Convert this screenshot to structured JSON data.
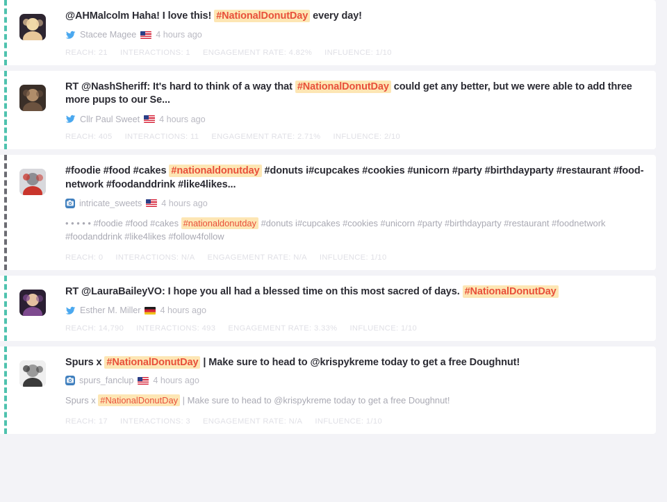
{
  "feed": {
    "metric_labels": {
      "reach": "REACH:",
      "interactions": "INTERACTIONS:",
      "engagement": "ENGAGEMENT RATE:",
      "influence": "INFLUENCE:"
    },
    "colors": {
      "page_background": "#f3f3f7",
      "card_background": "#ffffff",
      "twitter_stripe": "#4ec2ae",
      "instagram_stripe": "#6b6b72",
      "hashtag_highlight_bg": "#fde6b4",
      "hashtag_highlight_text": "#e8503a",
      "twitter_blue": "#4aa8ef",
      "instagram_blue": "#3f7fbe",
      "metrics_text": "#e0e0e6"
    },
    "posts": [
      {
        "id": "post-1",
        "network": "twitter",
        "network_icon": "twitter-bird-icon",
        "stripe_color": "#4ec2ae",
        "avatar_name": "avatar-stacee-magee",
        "text_parts": [
          {
            "text": "@AHMalcolm Haha! I love this! ",
            "highlight": false
          },
          {
            "text": "#NationalDonutDay",
            "highlight": true
          },
          {
            "text": " every day!",
            "highlight": false
          }
        ],
        "author": "Stacee Magee",
        "flag": "us",
        "time": "4 hours ago",
        "caption": null,
        "metrics": {
          "reach": "21",
          "interactions": "1",
          "engagement": "4.82%",
          "influence": "1/10"
        }
      },
      {
        "id": "post-2",
        "network": "twitter",
        "network_icon": "twitter-bird-icon",
        "stripe_color": "#4ec2ae",
        "avatar_name": "avatar-cllr-paul-sweet",
        "text_parts": [
          {
            "text": "RT @NashSheriff: It's hard to think of a way that ",
            "highlight": false
          },
          {
            "text": "#NationalDonutDay",
            "highlight": true
          },
          {
            "text": " could get any better, but we were able to add three more pups to our Se...",
            "highlight": false
          }
        ],
        "author": "Cllr Paul Sweet",
        "flag": "us",
        "time": "4 hours ago",
        "caption": null,
        "metrics": {
          "reach": "405",
          "interactions": "11",
          "engagement": "2.71%",
          "influence": "2/10"
        }
      },
      {
        "id": "post-3",
        "network": "instagram",
        "network_icon": "instagram-camera-icon",
        "stripe_color": "#6b6b72",
        "avatar_name": "avatar-intricate-sweets",
        "text_parts": [
          {
            "text": "#foodie #food #cakes ",
            "highlight": false
          },
          {
            "text": "#nationaldonutday",
            "highlight": true
          },
          {
            "text": " #donuts i#cupcakes #cookies #unicorn #party #birthdayparty #restaurant #food-network #foodanddrink #like4likes...",
            "highlight": false
          }
        ],
        "author": "intricate_sweets",
        "flag": "us",
        "time": "4 hours ago",
        "caption_parts": [
          {
            "text": "• • • • • #foodie #food #cakes ",
            "highlight": false
          },
          {
            "text": "#nationaldonutday",
            "highlight": true
          },
          {
            "text": " #donuts i#cupcakes #cookies #unicorn #party #birthdayparty #restaurant #foodnetwork #foodanddrink #like4likes #follow4follow",
            "highlight": false
          }
        ],
        "metrics": {
          "reach": "0",
          "interactions": "N/A",
          "engagement": "N/A",
          "influence": "1/10"
        }
      },
      {
        "id": "post-4",
        "network": "twitter",
        "network_icon": "twitter-bird-icon",
        "stripe_color": "#4ec2ae",
        "avatar_name": "avatar-esther-m-miller",
        "text_parts": [
          {
            "text": "RT @LauraBaileyVO: I hope you all had a blessed time on this most sacred of days. ",
            "highlight": false
          },
          {
            "text": "#NationalDonutDay",
            "highlight": true
          }
        ],
        "author": "Esther M. Miller",
        "flag": "de",
        "time": "4 hours ago",
        "caption": null,
        "metrics": {
          "reach": "14,790",
          "interactions": "493",
          "engagement": "3.33%",
          "influence": "1/10"
        }
      },
      {
        "id": "post-5",
        "network": "instagram",
        "network_icon": "instagram-camera-icon",
        "stripe_color": "#4ec2ae",
        "avatar_name": "avatar-spurs-fanclup",
        "text_parts": [
          {
            "text": "Spurs x ",
            "highlight": false
          },
          {
            "text": "#NationalDonutDay",
            "highlight": true
          },
          {
            "text": " | Make sure to head to @krispykreme today to get a free Doughnut!",
            "highlight": false
          }
        ],
        "author": "spurs_fanclup",
        "flag": "us",
        "time": "4 hours ago",
        "caption_parts": [
          {
            "text": "Spurs x ",
            "highlight": false
          },
          {
            "text": "#NationalDonutDay",
            "highlight": true
          },
          {
            "text": " | Make sure to head to @krispykreme today to get a free Doughnut!",
            "highlight": false
          }
        ],
        "metrics": {
          "reach": "17",
          "interactions": "3",
          "engagement": "N/A",
          "influence": "1/10"
        }
      }
    ]
  }
}
